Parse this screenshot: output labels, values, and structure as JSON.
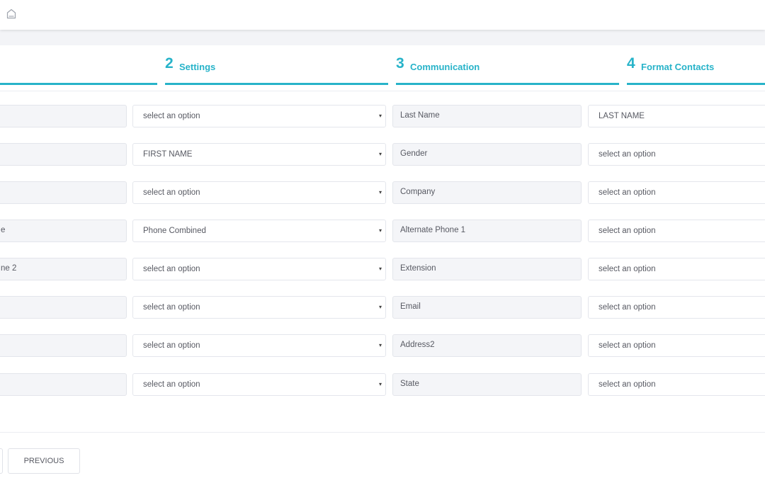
{
  "steps": [
    {
      "num": "2",
      "label": "Settings"
    },
    {
      "num": "3",
      "label": "Communication"
    },
    {
      "num": "4",
      "label": "Format Contacts"
    }
  ],
  "rows": [
    {
      "field_a": "",
      "select_a": "select an option",
      "field_b": "Last Name",
      "select_b": "LAST NAME"
    },
    {
      "field_a": "",
      "select_a": "FIRST NAME",
      "field_b": "Gender",
      "select_b": "select an option"
    },
    {
      "field_a": "",
      "select_a": "select an option",
      "field_b": "Company",
      "select_b": "select an option"
    },
    {
      "field_a": "e",
      "select_a": "Phone Combined",
      "field_b": "Alternate Phone 1",
      "select_b": "select an option"
    },
    {
      "field_a": "ne 2",
      "select_a": "select an option",
      "field_b": "Extension",
      "select_b": "select an option"
    },
    {
      "field_a": "",
      "select_a": "select an option",
      "field_b": "Email",
      "select_b": "select an option"
    },
    {
      "field_a": "",
      "select_a": "select an option",
      "field_b": "Address2",
      "select_b": "select an option"
    },
    {
      "field_a": "",
      "select_a": "select an option",
      "field_b": "State",
      "select_b": "select an option"
    }
  ],
  "caret": "▾",
  "buttons": {
    "previous": "PREVIOUS"
  },
  "colors": {
    "accent": "#27b3c9",
    "readonly_bg": "#f4f5f8",
    "border": "#e4e6ec",
    "band_bg": "#f3f4f7"
  },
  "icons": {
    "home": "home-icon",
    "dropdown": "caret-down-icon"
  }
}
